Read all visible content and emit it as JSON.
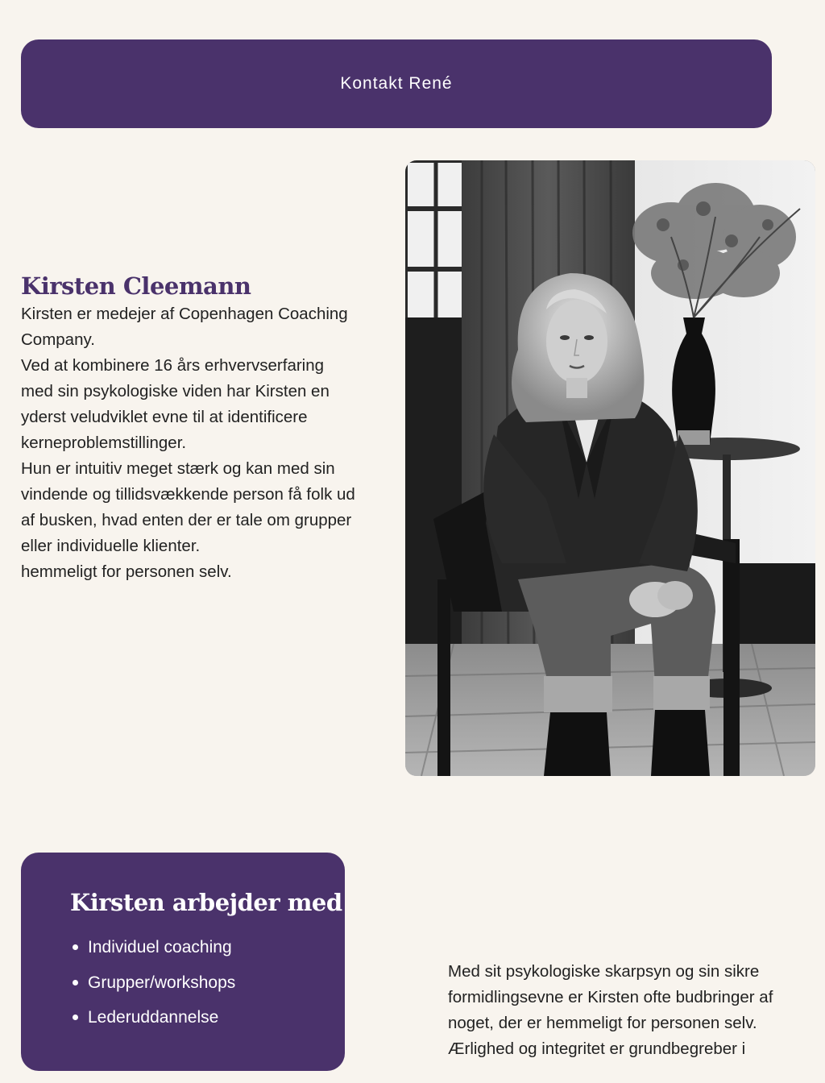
{
  "contact": {
    "label": "Kontakt René"
  },
  "bio": {
    "name": "Kirsten Cleemann",
    "paragraphs": [
      "Kirsten er medejer af Copenhagen Coaching Company.",
      "Ved at kombinere 16 års erhvervserfaring med sin psykologiske viden har Kirsten en yderst veludviklet evne til at identificere kerneproblemstillinger.",
      "Hun er intuitiv meget stærk og kan med sin vindende og tillidsvækkende person få folk ud af busken, hvad enten der er tale om grupper eller individuelle klienter.",
      "hemmeligt for personen selv."
    ]
  },
  "portrait": {
    "alt": "Kirsten Cleemann"
  },
  "works": {
    "title": "Kirsten arbejder med",
    "items": [
      "Individuel coaching",
      "Grupper/workshops",
      "Lederuddannelse"
    ]
  },
  "side_text": {
    "paragraphs": [
      "Med sit psykologiske skarpsyn og sin sikre formidlingsevne er Kirsten ofte budbringer af noget, der er hemmeligt for personen selv.",
      "Ærlighed og integritet er grundbegreber i"
    ]
  },
  "colors": {
    "background": "#f8f4ee",
    "accent": "#4a326b",
    "text": "#222222"
  }
}
